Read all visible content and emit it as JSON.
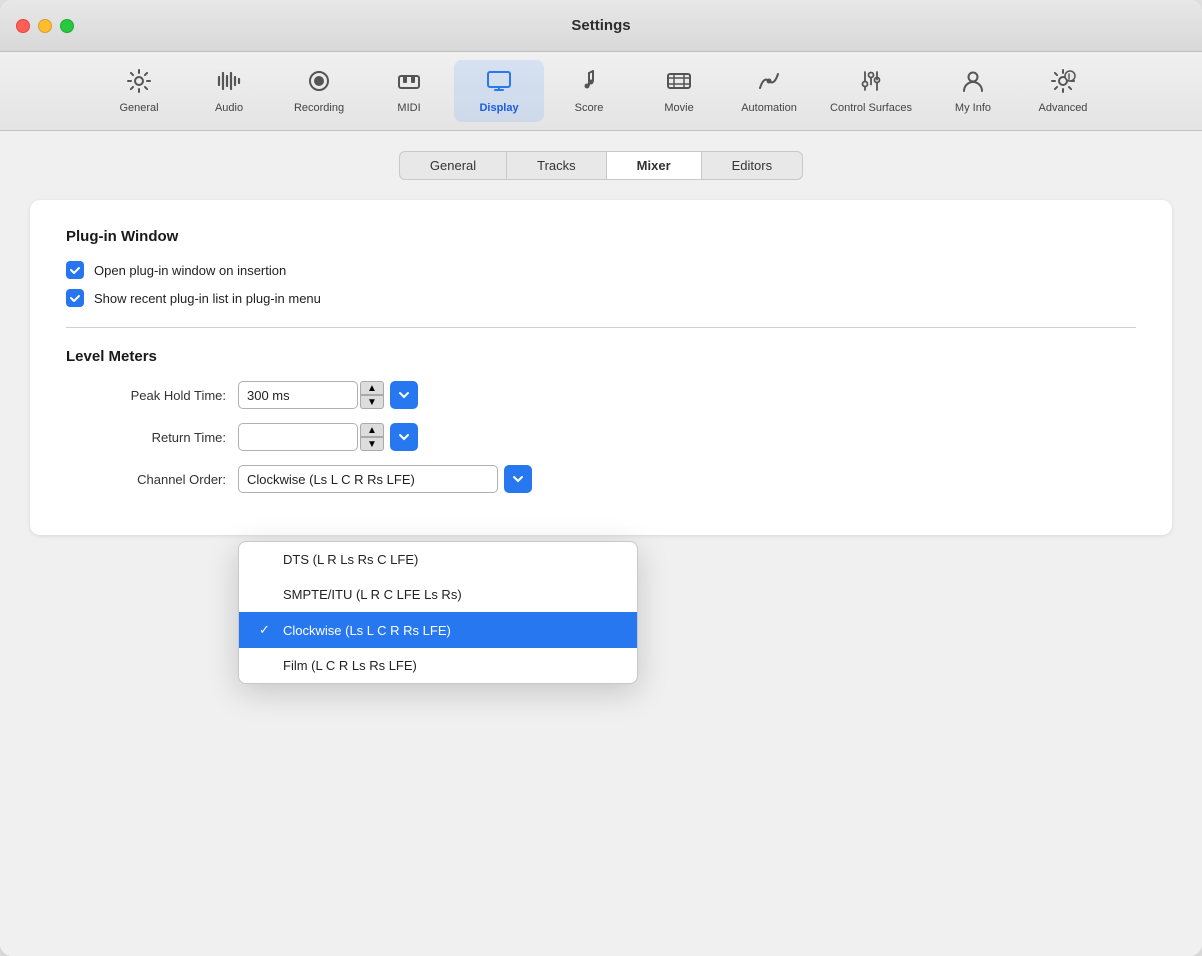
{
  "window": {
    "title": "Settings"
  },
  "toolbar": {
    "items": [
      {
        "id": "general",
        "label": "General",
        "icon": "⚙️",
        "active": false
      },
      {
        "id": "audio",
        "label": "Audio",
        "icon": "🎛️",
        "active": false
      },
      {
        "id": "recording",
        "label": "Recording",
        "icon": "⏺",
        "active": false
      },
      {
        "id": "midi",
        "label": "MIDI",
        "icon": "🎹",
        "active": false
      },
      {
        "id": "display",
        "label": "Display",
        "icon": "🖥️",
        "active": true
      },
      {
        "id": "score",
        "label": "Score",
        "icon": "🎼",
        "active": false
      },
      {
        "id": "movie",
        "label": "Movie",
        "icon": "🎞️",
        "active": false
      },
      {
        "id": "automation",
        "label": "Automation",
        "icon": "⚙️",
        "active": false
      },
      {
        "id": "control-surfaces",
        "label": "Control Surfaces",
        "icon": "🎚️",
        "active": false
      },
      {
        "id": "my-info",
        "label": "My Info",
        "icon": "👤",
        "active": false
      },
      {
        "id": "advanced",
        "label": "Advanced",
        "icon": "⚙️",
        "active": false
      }
    ]
  },
  "tabs": [
    {
      "id": "general",
      "label": "General",
      "active": false
    },
    {
      "id": "tracks",
      "label": "Tracks",
      "active": false
    },
    {
      "id": "mixer",
      "label": "Mixer",
      "active": true
    },
    {
      "id": "editors",
      "label": "Editors",
      "active": false
    }
  ],
  "plugin_window_section": {
    "title": "Plug-in Window",
    "checkboxes": [
      {
        "id": "open-on-insertion",
        "label": "Open plug-in window on insertion",
        "checked": true
      },
      {
        "id": "show-recent-list",
        "label": "Show recent plug-in list in plug-in menu",
        "checked": true
      }
    ]
  },
  "level_meters_section": {
    "title": "Level Meters",
    "peak_hold_time": {
      "label": "Peak Hold Time:",
      "value": "300 ms"
    },
    "return_time": {
      "label": "Return Time:",
      "value": ""
    },
    "channel_order": {
      "label": "Channel Order:"
    }
  },
  "dropdown": {
    "options": [
      {
        "id": "dts",
        "label": "DTS (L R Ls Rs C LFE)",
        "selected": false
      },
      {
        "id": "smpte",
        "label": "SMPTE/ITU (L R C LFE Ls Rs)",
        "selected": false
      },
      {
        "id": "clockwise",
        "label": "Clockwise (Ls L C R Rs LFE)",
        "selected": true
      },
      {
        "id": "film",
        "label": "Film (L C R Ls Rs LFE)",
        "selected": false
      }
    ]
  }
}
